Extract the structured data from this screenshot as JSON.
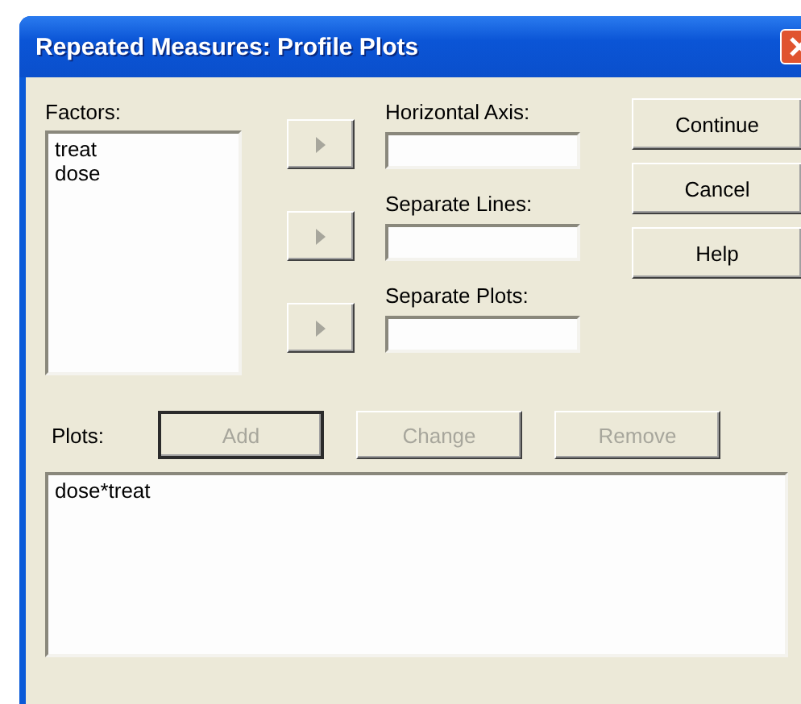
{
  "window": {
    "title": "Repeated Measures: Profile Plots"
  },
  "factors": {
    "label": "Factors:",
    "items": [
      "treat",
      "dose"
    ]
  },
  "targets": [
    {
      "label": "Horizontal Axis:",
      "arrow_disabled": true
    },
    {
      "label": "Separate Lines:",
      "arrow_disabled": true
    },
    {
      "label": "Separate Plots:",
      "arrow_disabled": true
    }
  ],
  "side_buttons": [
    {
      "label": "Continue",
      "disabled": false
    },
    {
      "label": "Cancel",
      "disabled": false
    },
    {
      "label": "Help",
      "disabled": false
    }
  ],
  "plots": {
    "label": "Plots:",
    "buttons": [
      {
        "label": "Add",
        "disabled": true,
        "default": true
      },
      {
        "label": "Change",
        "disabled": true,
        "default": false
      },
      {
        "label": "Remove",
        "disabled": true,
        "default": false
      }
    ],
    "items": [
      "dose*treat"
    ]
  }
}
